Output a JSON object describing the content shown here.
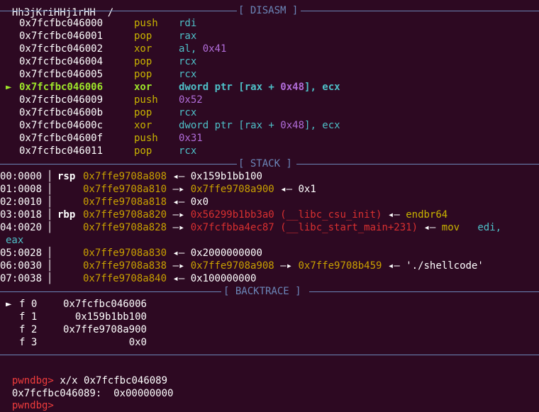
{
  "top_partial": "Hh3jKriHHj1rHH  /",
  "disasm": {
    "header": "[ DISASM ]",
    "rows": [
      {
        "addr": "0x7fcfbc046000",
        "mn": "push",
        "op": "rdi"
      },
      {
        "addr": "0x7fcfbc046001",
        "mn": "pop",
        "op": "rax"
      },
      {
        "addr": "0x7fcfbc046002",
        "mn": "xor",
        "op": "al, ",
        "num": "0x41"
      },
      {
        "addr": "0x7fcfbc046004",
        "mn": "pop",
        "op": "rcx"
      },
      {
        "addr": "0x7fcfbc046005",
        "mn": "pop",
        "op": "rcx"
      },
      {
        "addr": "0x7fcfbc046006",
        "mn": "xor",
        "op": "dword ptr [rax + ",
        "num": "0x48",
        "op2": "], ecx",
        "current": true,
        "marker": "►"
      },
      {
        "addr": "0x7fcfbc046009",
        "mn": "push",
        "num": "0x52"
      },
      {
        "addr": "0x7fcfbc04600b",
        "mn": "pop",
        "op": "rcx"
      },
      {
        "addr": "0x7fcfbc04600c",
        "mn": "xor",
        "op": "dword ptr [rax + ",
        "num": "0x48",
        "op2": "], ecx"
      },
      {
        "addr": "0x7fcfbc04600f",
        "mn": "push",
        "num": "0x31"
      },
      {
        "addr": "0x7fcfbc046011",
        "mn": "pop",
        "op": "rcx"
      }
    ]
  },
  "stack": {
    "header": "[ STACK ]",
    "rows": [
      {
        "idx": "00:0000",
        "reg": "rsp",
        "addr": "0x7ffe9708a808",
        "chain": [
          {
            "t": "arrow",
            "v": "◂—"
          },
          {
            "t": "w",
            "v": "0x159b1bb100"
          }
        ]
      },
      {
        "idx": "01:0008",
        "reg": "",
        "addr": "0x7ffe9708a810",
        "chain": [
          {
            "t": "arrow",
            "v": "—▸"
          },
          {
            "t": "stk",
            "v": "0x7ffe9708a900"
          },
          {
            "t": "arrow",
            "v": "◂—"
          },
          {
            "t": "w",
            "v": "0x1"
          }
        ]
      },
      {
        "idx": "02:0010",
        "reg": "",
        "addr": "0x7ffe9708a818",
        "chain": [
          {
            "t": "arrow",
            "v": "◂—"
          },
          {
            "t": "w",
            "v": "0x0"
          }
        ]
      },
      {
        "idx": "03:0018",
        "reg": "rbp",
        "addr": "0x7ffe9708a820",
        "chain": [
          {
            "t": "arrow",
            "v": "—▸"
          },
          {
            "t": "cod",
            "v": "0x56299b1bb3a0 (__libc_csu_init)"
          },
          {
            "t": "arrow",
            "v": "◂—"
          },
          {
            "t": "mn",
            "v": "endbr64"
          }
        ]
      },
      {
        "idx": "04:0020",
        "reg": "",
        "addr": "0x7ffe9708a828",
        "chain": [
          {
            "t": "arrow",
            "v": "—▸"
          },
          {
            "t": "cod",
            "v": "0x7fcfbba4ec87 (__libc_start_main+231)"
          },
          {
            "t": "arrow",
            "v": "◂—"
          },
          {
            "t": "mn",
            "v": "mov"
          },
          {
            "t": "op",
            "v": "edi,"
          }
        ]
      },
      {
        "idx": "05:0028",
        "reg": "",
        "addr": "0x7ffe9708a830",
        "chain": [
          {
            "t": "arrow",
            "v": "◂—"
          },
          {
            "t": "w",
            "v": "0x2000000000"
          }
        ]
      },
      {
        "idx": "06:0030",
        "reg": "",
        "addr": "0x7ffe9708a838",
        "chain": [
          {
            "t": "arrow",
            "v": "—▸"
          },
          {
            "t": "stk",
            "v": "0x7ffe9708a908"
          },
          {
            "t": "arrow",
            "v": "—▸"
          },
          {
            "t": "stk",
            "v": "0x7ffe9708b459"
          },
          {
            "t": "arrow",
            "v": "◂—"
          },
          {
            "t": "w",
            "v": "'./shellcode'"
          }
        ]
      },
      {
        "idx": "07:0038",
        "reg": "",
        "addr": "0x7ffe9708a840",
        "chain": [
          {
            "t": "arrow",
            "v": "◂—"
          },
          {
            "t": "w",
            "v": "0x100000000"
          }
        ]
      }
    ],
    "wrap": "eax"
  },
  "backtrace": {
    "header": "[ BACKTRACE ]",
    "frames": [
      {
        "marker": "►",
        "label": "f 0",
        "addr": "0x7fcfbc046006"
      },
      {
        "marker": "",
        "label": "f 1",
        "addr": "0x159b1bb100"
      },
      {
        "marker": "",
        "label": "f 2",
        "addr": "0x7ffe9708a900"
      },
      {
        "marker": "",
        "label": "f 3",
        "addr": "0x0"
      }
    ]
  },
  "prompt": {
    "name": "pwndbg>",
    "command": "x/x 0x7fcfbc046089",
    "output": "0x7fcfbc046089:  0x00000000",
    "next_partial": "pwndbg> "
  },
  "colors": {
    "background": "#2d0922",
    "separator": "#6b86b8",
    "mnemonic": "#c9b400",
    "operand": "#4ec0c8",
    "number": "#b06cd8",
    "stack_addr": "#c9a000",
    "code_addr": "#d93030",
    "current": "#9ee62a",
    "prompt": "#ef3c3c"
  }
}
